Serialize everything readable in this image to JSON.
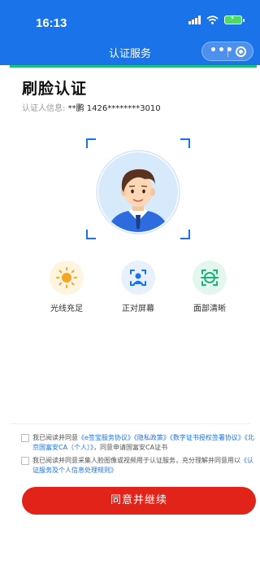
{
  "status_bar": {
    "time": "16:13"
  },
  "nav": {
    "title": "认证服务"
  },
  "page": {
    "title": "刷脸认证",
    "info_label": "认证人信息:",
    "info_value": "**鹏 1426********3010"
  },
  "tips": [
    {
      "label": "光线充足",
      "icon": "sun-icon",
      "color": "#f5a623",
      "bg": "#fff4e0"
    },
    {
      "label": "正对屏幕",
      "icon": "face-frame-icon",
      "color": "#1a73e8",
      "bg": "#e9f0fd"
    },
    {
      "label": "面部清晰",
      "icon": "face-scan-icon",
      "color": "#19b37a",
      "bg": "#e4f7ef"
    }
  ],
  "agreements": {
    "first": {
      "prefix": "我已阅读并同意",
      "link1": "《e签宝服务协议》",
      "link2": "《隐私政策》",
      "link3": "《数字证书授权签署协议》",
      "link4": "《北京国富安CA（个人）》",
      "suffix": "，同意申请国富安CA证书"
    },
    "second": {
      "prefix": "我已阅读并同意采集人脸图像或视频用于认证服务，充分理解并同意用以",
      "link1": "《认证服务及个人信息处理规则》"
    }
  },
  "cta": {
    "label": "同意并继续"
  },
  "colors": {
    "primary": "#1a73e8",
    "accent": "#e2231a",
    "progress": "#19c37d"
  }
}
